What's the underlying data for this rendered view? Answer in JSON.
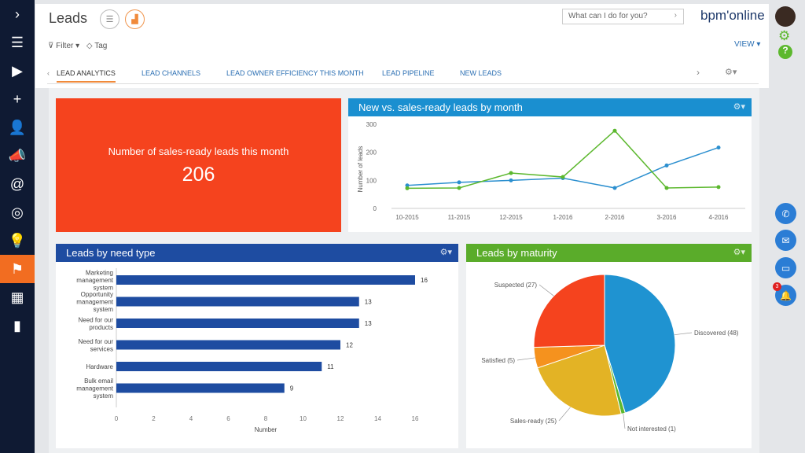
{
  "sidebar": {
    "items": [
      {
        "icon": "chevron-right-icon",
        "glyph": "›"
      },
      {
        "icon": "menu-icon",
        "glyph": "☰"
      },
      {
        "icon": "play-icon",
        "glyph": "▶"
      },
      {
        "icon": "plus-icon",
        "glyph": "+"
      },
      {
        "icon": "contact-icon",
        "glyph": "👤"
      },
      {
        "icon": "megaphone-icon",
        "glyph": "📣"
      },
      {
        "icon": "at-icon",
        "glyph": "@"
      },
      {
        "icon": "target-icon",
        "glyph": "◎"
      },
      {
        "icon": "lightbulb-icon",
        "glyph": "💡"
      },
      {
        "icon": "leads-icon",
        "glyph": "⚑",
        "active": true
      },
      {
        "icon": "building-icon",
        "glyph": "▦"
      },
      {
        "icon": "analytics-icon",
        "glyph": "▮"
      }
    ]
  },
  "header": {
    "title": "Leads",
    "filter_label": "Filter ▾",
    "tag_label": "Tag",
    "search_placeholder": "What can I do for you?",
    "logo": "bpm'online",
    "view_label": "VIEW ▾"
  },
  "tabs": [
    {
      "label": "LEAD ANALYTICS",
      "active": true
    },
    {
      "label": "LEAD CHANNELS"
    },
    {
      "label": "LEAD OWNER EFFICIENCY THIS MONTH"
    },
    {
      "label": "LEAD PIPELINE"
    },
    {
      "label": "NEW LEADS"
    }
  ],
  "kpi": {
    "title": "Number of sales-ready leads this month",
    "value": "206",
    "color": "#f5431e"
  },
  "colors": {
    "blue_header": "#1a8fd0",
    "navy_header": "#1e4ca1",
    "green_header": "#5aac2a",
    "accent": "#f26d21"
  },
  "chart_data": [
    {
      "type": "line",
      "title": "New vs. sales-ready leads by month",
      "ylabel": "Number of leads",
      "xlabel": "",
      "ylim": [
        0,
        300
      ],
      "yticks": [
        0,
        100,
        200,
        300
      ],
      "categories": [
        "10-2015",
        "11-2015",
        "12-2015",
        "1-2016",
        "2-2016",
        "3-2016",
        "4-2016"
      ],
      "series": [
        {
          "color": "#2b8fcf",
          "values": [
            82,
            93,
            100,
            108,
            73,
            153,
            217
          ]
        },
        {
          "color": "#5cb82e",
          "values": [
            72,
            73,
            126,
            112,
            277,
            73,
            76
          ]
        }
      ]
    },
    {
      "type": "bar",
      "orientation": "horizontal",
      "title": "Leads by need type",
      "xlabel": "Number",
      "xlim": [
        0,
        16
      ],
      "xticks": [
        0,
        2,
        4,
        6,
        8,
        10,
        12,
        14,
        16
      ],
      "color": "#1e4ca1",
      "categories": [
        "Marketing management system",
        "Opportunity management system",
        "Need for our products",
        "Need for our services",
        "Hardware",
        "Bulk email management system"
      ],
      "values": [
        16,
        13,
        13,
        12,
        11,
        9
      ]
    },
    {
      "type": "pie",
      "title": "Leads by maturity",
      "slices": [
        {
          "label": "Discovered (48)",
          "value": 48,
          "color": "#1f93d1"
        },
        {
          "label": "Not interested (1)",
          "value": 1,
          "color": "#5cb82e"
        },
        {
          "label": "Sales-ready (25)",
          "value": 25,
          "color": "#e3b325"
        },
        {
          "label": "Satisfied (5)",
          "value": 5,
          "color": "#f5921e"
        },
        {
          "label": "Suspected (27)",
          "value": 27,
          "color": "#f5431e"
        }
      ]
    }
  ],
  "rail": {
    "notification_count": "3"
  }
}
